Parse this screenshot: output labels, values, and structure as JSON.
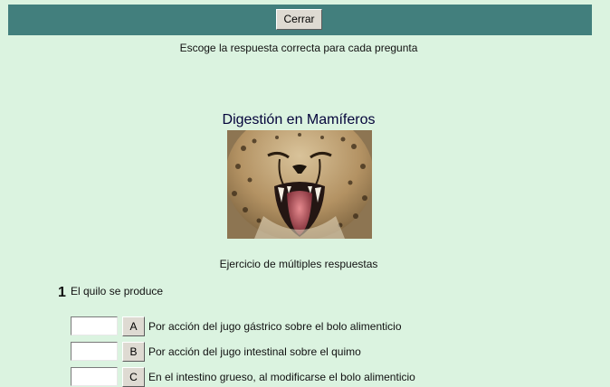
{
  "header": {
    "close_label": "Cerrar"
  },
  "instructions": "Escoge la respuesta correcta para cada pregunta",
  "quiz_title": "Digestión en Mamíferos",
  "image": {
    "subject": "cheetah-yawning-photo"
  },
  "exercise_type": "Ejercicio de múltiples respuestas",
  "question": {
    "number": "1",
    "text": "El quilo se produce",
    "answers": [
      {
        "letter": "A",
        "text": "Por acción del jugo gástrico sobre el bolo alimenticio",
        "value": ""
      },
      {
        "letter": "B",
        "text": "Por acción del jugo intestinal sobre el quimo",
        "value": ""
      },
      {
        "letter": "C",
        "text": "En el intestino grueso, al modificarse el bolo alimenticio",
        "value": ""
      }
    ]
  },
  "colors": {
    "page_background": "#dbf3e0",
    "header_bar": "#427f7d",
    "button_face": "#dedad2",
    "title_text": "#04043a"
  }
}
